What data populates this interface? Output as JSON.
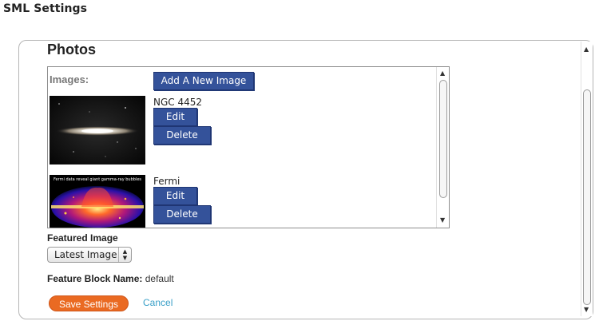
{
  "window": {
    "title": "SML Settings"
  },
  "section": {
    "title": "Photos"
  },
  "images": {
    "label": "Images:",
    "add_button": "Add A New Image",
    "items": [
      {
        "name": "NGC 4452",
        "edit_label": "Edit",
        "delete_label": "Delete"
      },
      {
        "name": "Fermi",
        "edit_label": "Edit",
        "delete_label": "Delete",
        "thumbnail_caption": "Fermi data reveal giant gamma-ray bubbles"
      }
    ]
  },
  "featured": {
    "label": "Featured Image",
    "selected": "Latest Image"
  },
  "feature_block": {
    "label": "Feature Block Name:",
    "value": "default"
  },
  "actions": {
    "save_label": "Save Settings",
    "cancel_label": "Cancel"
  },
  "colors": {
    "primary_button": "#34529a",
    "save_button": "#ea6a22",
    "link": "#3aa0c8"
  }
}
